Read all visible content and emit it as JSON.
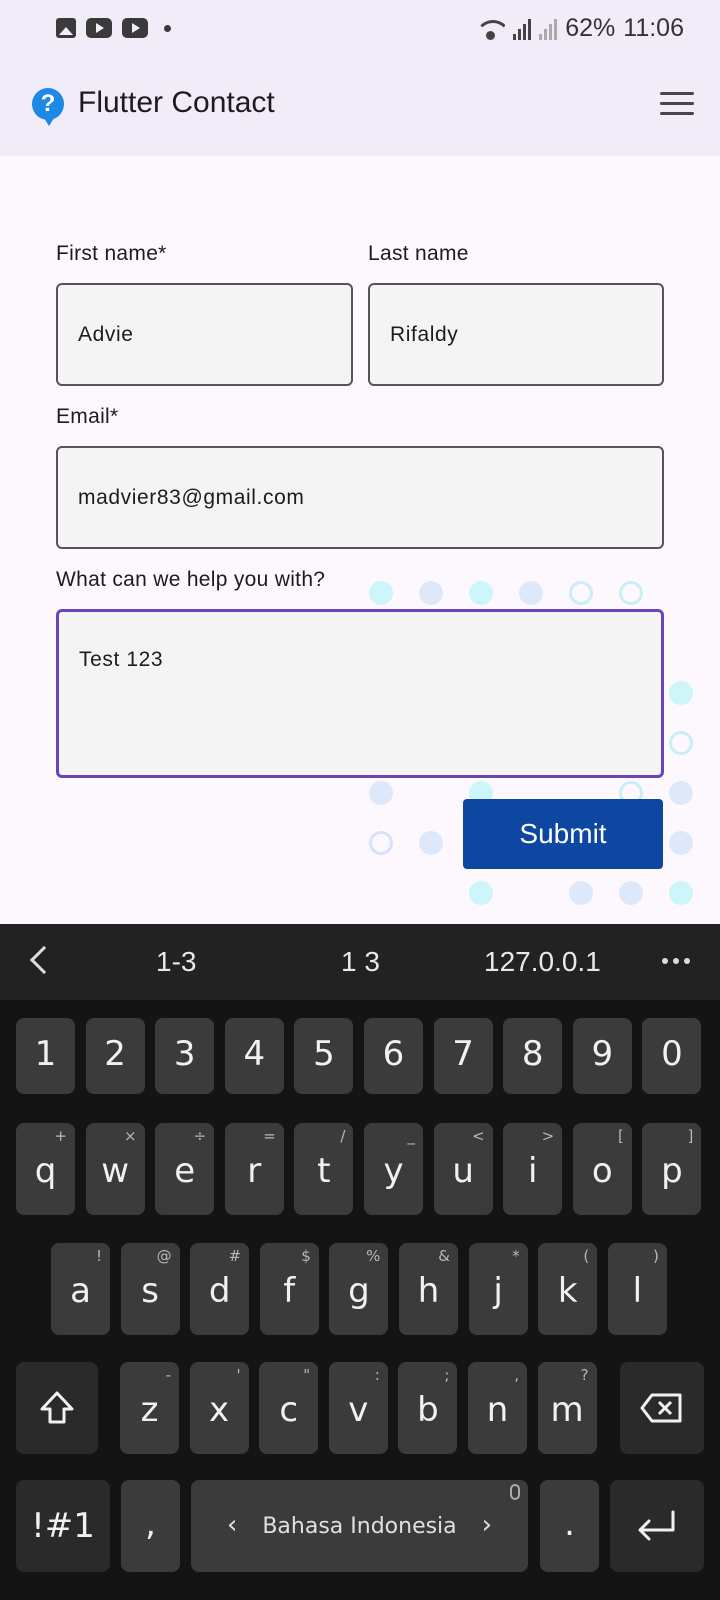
{
  "status_bar": {
    "battery": "62%",
    "time": "11:06"
  },
  "app_bar": {
    "title": "Flutter Contact",
    "logo_glyph": "?"
  },
  "form": {
    "first_name": {
      "label": "First name*",
      "value": "Advie"
    },
    "last_name": {
      "label": "Last name",
      "value": "Rifaldy"
    },
    "email": {
      "label": "Email*",
      "value": "madvier83@gmail.com"
    },
    "message": {
      "label": "What can we help you with?",
      "value": "Test 123"
    },
    "submit_label": "Submit"
  },
  "keyboard": {
    "suggestions": [
      "1-3",
      "1 3",
      "127.0.0.1"
    ],
    "number_row": [
      "1",
      "2",
      "3",
      "4",
      "5",
      "6",
      "7",
      "8",
      "9",
      "0"
    ],
    "row1": [
      {
        "key": "q",
        "sub": "+"
      },
      {
        "key": "w",
        "sub": "×"
      },
      {
        "key": "e",
        "sub": "÷"
      },
      {
        "key": "r",
        "sub": "="
      },
      {
        "key": "t",
        "sub": "/"
      },
      {
        "key": "y",
        "sub": "_"
      },
      {
        "key": "u",
        "sub": "<"
      },
      {
        "key": "i",
        "sub": ">"
      },
      {
        "key": "o",
        "sub": "["
      },
      {
        "key": "p",
        "sub": "]"
      }
    ],
    "row2": [
      {
        "key": "a",
        "sub": "!"
      },
      {
        "key": "s",
        "sub": "@"
      },
      {
        "key": "d",
        "sub": "#"
      },
      {
        "key": "f",
        "sub": "$"
      },
      {
        "key": "g",
        "sub": "%"
      },
      {
        "key": "h",
        "sub": "&"
      },
      {
        "key": "j",
        "sub": "*"
      },
      {
        "key": "k",
        "sub": "("
      },
      {
        "key": "l",
        "sub": ")"
      }
    ],
    "row3": [
      {
        "key": "z",
        "sub": "-"
      },
      {
        "key": "x",
        "sub": "'"
      },
      {
        "key": "c",
        "sub": "\""
      },
      {
        "key": "v",
        "sub": ":"
      },
      {
        "key": "b",
        "sub": ";"
      },
      {
        "key": "n",
        "sub": ","
      },
      {
        "key": "m",
        "sub": "?"
      }
    ],
    "symbols_key": "!#1",
    "comma_key": ",",
    "space_label": "Bahasa Indonesia",
    "period_key": "."
  },
  "colors": {
    "accent": "#6a45b8",
    "submit": "#0d47a1",
    "appbar": "#f1ecf8"
  }
}
